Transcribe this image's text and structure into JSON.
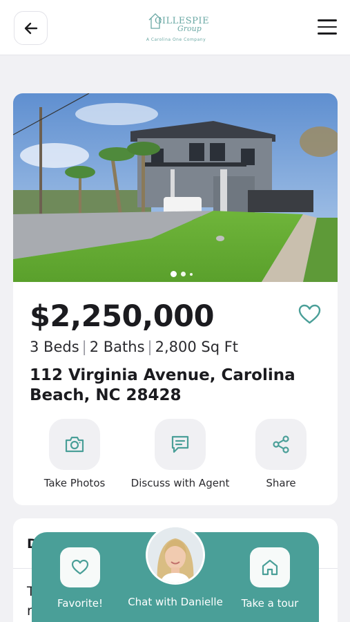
{
  "header": {
    "logo_title": "GILLESPIE",
    "logo_script": "Group",
    "logo_subtitle": "A Carolina One Company"
  },
  "listing": {
    "price": "$2,250,000",
    "beds": "3 Beds",
    "baths": "2 Baths",
    "sqft": "2,800 Sq Ft",
    "separator": "|",
    "address": "112 Virginia Avenue, Carolina Beach, NC 28428",
    "photo_count": 3,
    "active_photo": 1
  },
  "actions": {
    "take_photos": "Take Photos",
    "discuss": "Discuss with Agent",
    "share": "Share"
  },
  "details_card": {
    "heading_initial": "D",
    "text_line1": "T",
    "text_line2": "r"
  },
  "dock": {
    "favorite": "Favorite!",
    "chat": "Chat with Danielle",
    "tour": "Take a tour"
  },
  "colors": {
    "accent": "#4a9f98",
    "logo": "#6aa8a4",
    "background": "#f1f1f4"
  },
  "icons": [
    "back-arrow-icon",
    "house-logo-icon",
    "hamburger-menu-icon",
    "heart-icon",
    "camera-icon",
    "chat-bubble-icon",
    "share-icon",
    "home-icon"
  ]
}
